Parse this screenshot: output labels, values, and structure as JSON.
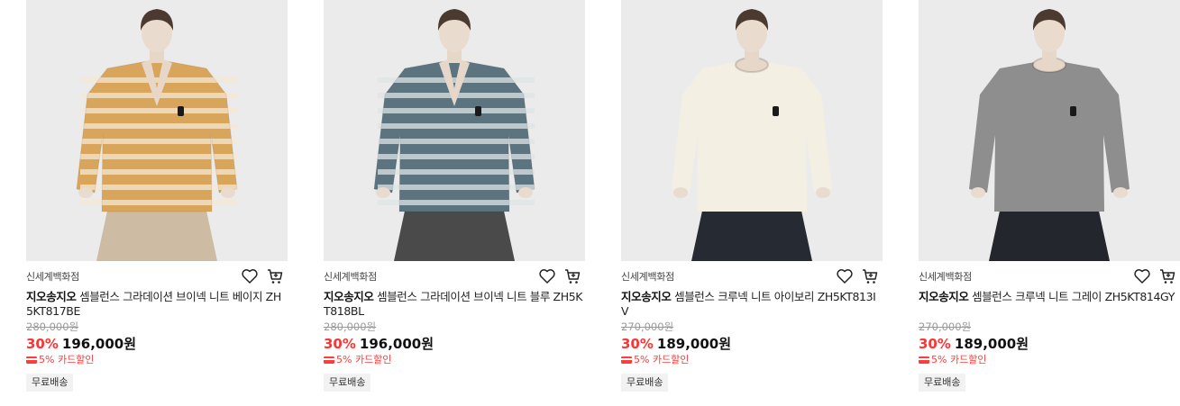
{
  "products": [
    {
      "store": "신세계백화점",
      "brand": "지오송지오",
      "name": "셈블런스 그라데이션 브이넥 니트 베이지 ZH5KT817BE",
      "original_price": "280,000원",
      "discount": "30%",
      "price": "196,000원",
      "card_benefit": "5% 카드할인",
      "shipping": "무료배송",
      "sweater_color": "#d9a55a",
      "stripe_color": "#f4e8d4",
      "pants_color": "#cdbba3",
      "neck": "v"
    },
    {
      "store": "신세계백화점",
      "brand": "지오송지오",
      "name": "셈블런스 그라데이션 브이넥 니트 블루 ZH5KT818BL",
      "original_price": "280,000원",
      "discount": "30%",
      "price": "196,000원",
      "card_benefit": "5% 카드할인",
      "shipping": "무료배송",
      "sweater_color": "#5c7480",
      "stripe_color": "#dde4e6",
      "pants_color": "#4a4a4a",
      "neck": "v"
    },
    {
      "store": "신세계백화점",
      "brand": "지오송지오",
      "name": "셈블런스 크루넥 니트 아이보리 ZH5KT813IV",
      "original_price": "270,000원",
      "discount": "30%",
      "price": "189,000원",
      "card_benefit": "5% 카드할인",
      "shipping": "무료배송",
      "sweater_color": "#f3efe2",
      "stripe_color": "#f3efe2",
      "pants_color": "#262a33",
      "neck": "crew"
    },
    {
      "store": "신세계백화점",
      "brand": "지오송지오",
      "name": "셈블런스 크루넥 니트 그레이 ZH5KT814GY",
      "original_price": "270,000원",
      "discount": "30%",
      "price": "189,000원",
      "card_benefit": "5% 카드할인",
      "shipping": "무료배송",
      "sweater_color": "#8e8e8e",
      "stripe_color": "#8e8e8e",
      "pants_color": "#23262c",
      "neck": "crew"
    }
  ],
  "icons": {
    "wishlist": "heart-outline-icon",
    "cart": "shopping-cart-icon",
    "card": "credit-card-icon"
  }
}
